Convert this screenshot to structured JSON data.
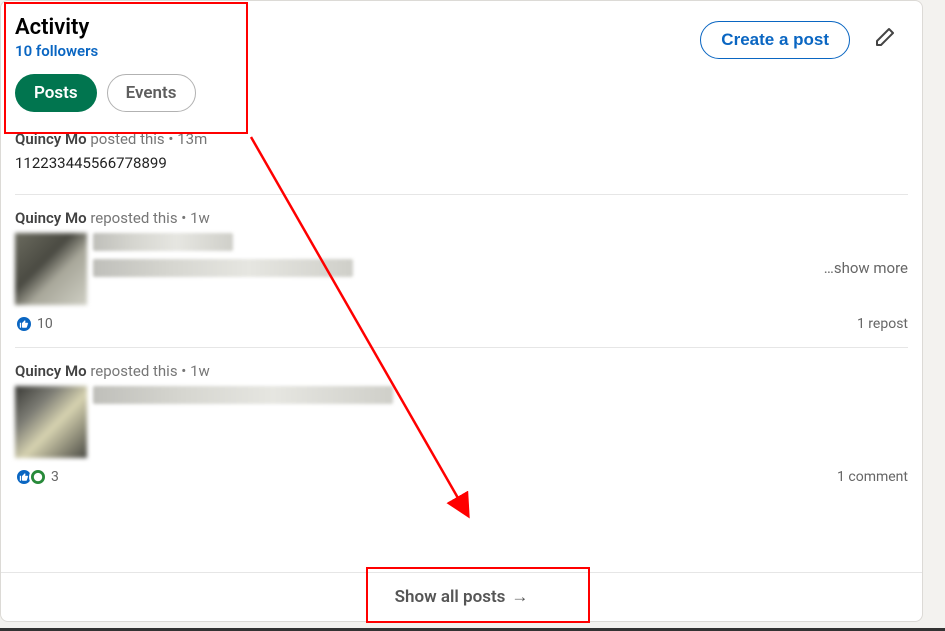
{
  "header": {
    "title": "Activity",
    "followers": "10 followers",
    "create_post_label": "Create a post"
  },
  "tabs": {
    "posts": "Posts",
    "events": "Events"
  },
  "posts": [
    {
      "author": "Quincy Mo",
      "action": "posted this",
      "sep": "•",
      "time": "13m",
      "body": "112233445566778899"
    },
    {
      "author": "Quincy Mo",
      "action": "reposted this",
      "sep": "•",
      "time": "1w",
      "show_more": "…show more",
      "reactions": "10",
      "right_stat": "1 repost"
    },
    {
      "author": "Quincy Mo",
      "action": "reposted this",
      "sep": "•",
      "time": "1w",
      "reactions": "3",
      "right_stat": "1 comment"
    }
  ],
  "footer": {
    "show_all": "Show all posts",
    "arrow": "→"
  }
}
